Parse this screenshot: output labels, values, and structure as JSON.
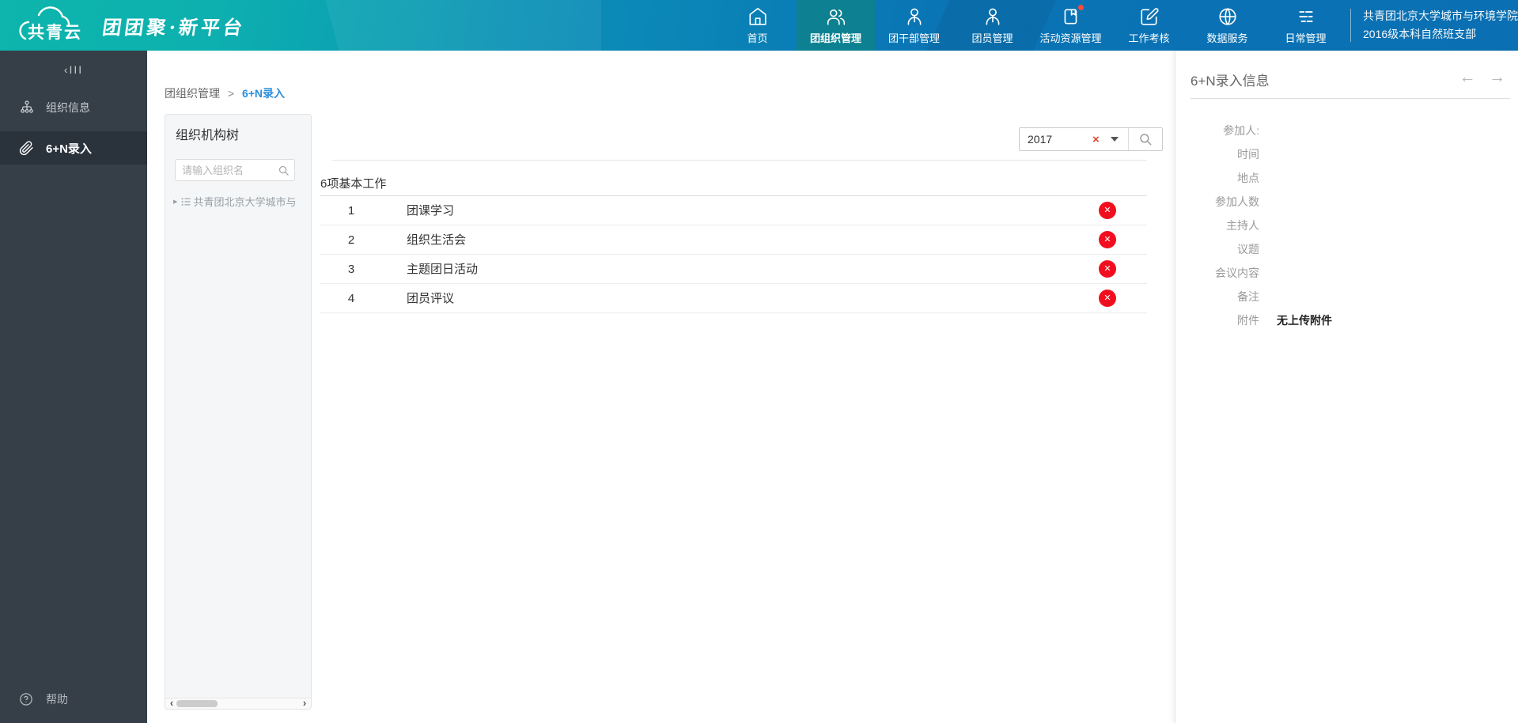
{
  "header": {
    "logo_text": "共青云",
    "slogan": "团团聚·新平台",
    "nav": [
      {
        "label": "首页",
        "icon": "home-icon",
        "active": false
      },
      {
        "label": "团组织管理",
        "icon": "users-icon",
        "active": true
      },
      {
        "label": "团干部管理",
        "icon": "user-icon",
        "active": false
      },
      {
        "label": "团员管理",
        "icon": "user-icon",
        "active": false
      },
      {
        "label": "活动资源管理",
        "icon": "resource-icon",
        "active": false,
        "badge": true
      },
      {
        "label": "工作考核",
        "icon": "edit-icon",
        "active": false
      },
      {
        "label": "数据服务",
        "icon": "globe-icon",
        "active": false
      },
      {
        "label": "日常管理",
        "icon": "list-icon",
        "active": false
      }
    ],
    "org_line1": "共青团北京大学城市与环境学院",
    "org_line2": "2016级本科自然班支部"
  },
  "sidebar": {
    "collapse_glyph": "‹III",
    "items": [
      {
        "label": "组织信息",
        "icon": "org-tree-icon",
        "selected": false
      },
      {
        "label": "6+N录入",
        "icon": "paperclip-icon",
        "selected": true
      }
    ],
    "help_label": "帮助"
  },
  "breadcrumb": {
    "parent": "团组织管理",
    "sep": ">",
    "current": "6+N录入"
  },
  "org_panel": {
    "title": "组织机构树",
    "search_placeholder": "请输入组织名",
    "tree_item": "共青团北京大学城市与"
  },
  "main": {
    "filter": {
      "value": "2017"
    },
    "list_title": "6项基本工作",
    "rows": [
      {
        "no": "1",
        "name": "团课学习"
      },
      {
        "no": "2",
        "name": "组织生活会"
      },
      {
        "no": "3",
        "name": "主题团日活动"
      },
      {
        "no": "4",
        "name": "团员评议"
      }
    ]
  },
  "detail": {
    "title": "6+N录入信息",
    "fields": [
      {
        "label": "参加人:",
        "value": ""
      },
      {
        "label": "时间",
        "value": ""
      },
      {
        "label": "地点",
        "value": ""
      },
      {
        "label": "参加人数",
        "value": ""
      },
      {
        "label": "主持人",
        "value": ""
      },
      {
        "label": "议题",
        "value": ""
      },
      {
        "label": "会议内容",
        "value": ""
      },
      {
        "label": "备注",
        "value": ""
      },
      {
        "label": "附件",
        "value": "无上传附件"
      }
    ]
  },
  "icons": {
    "close": "✕",
    "clear": "×",
    "caret_right": "▸",
    "arrow_left": "←",
    "arrow_right": "→",
    "scroll_left": "‹",
    "scroll_right": "›"
  },
  "colors": {
    "accent_teal": "#0db5ac",
    "accent_blue": "#0a71b4",
    "active_tab": "#0d8191",
    "sidebar_bg": "#363f48",
    "danger_red": "#f10f1f",
    "link_blue": "#2b8fdd"
  }
}
